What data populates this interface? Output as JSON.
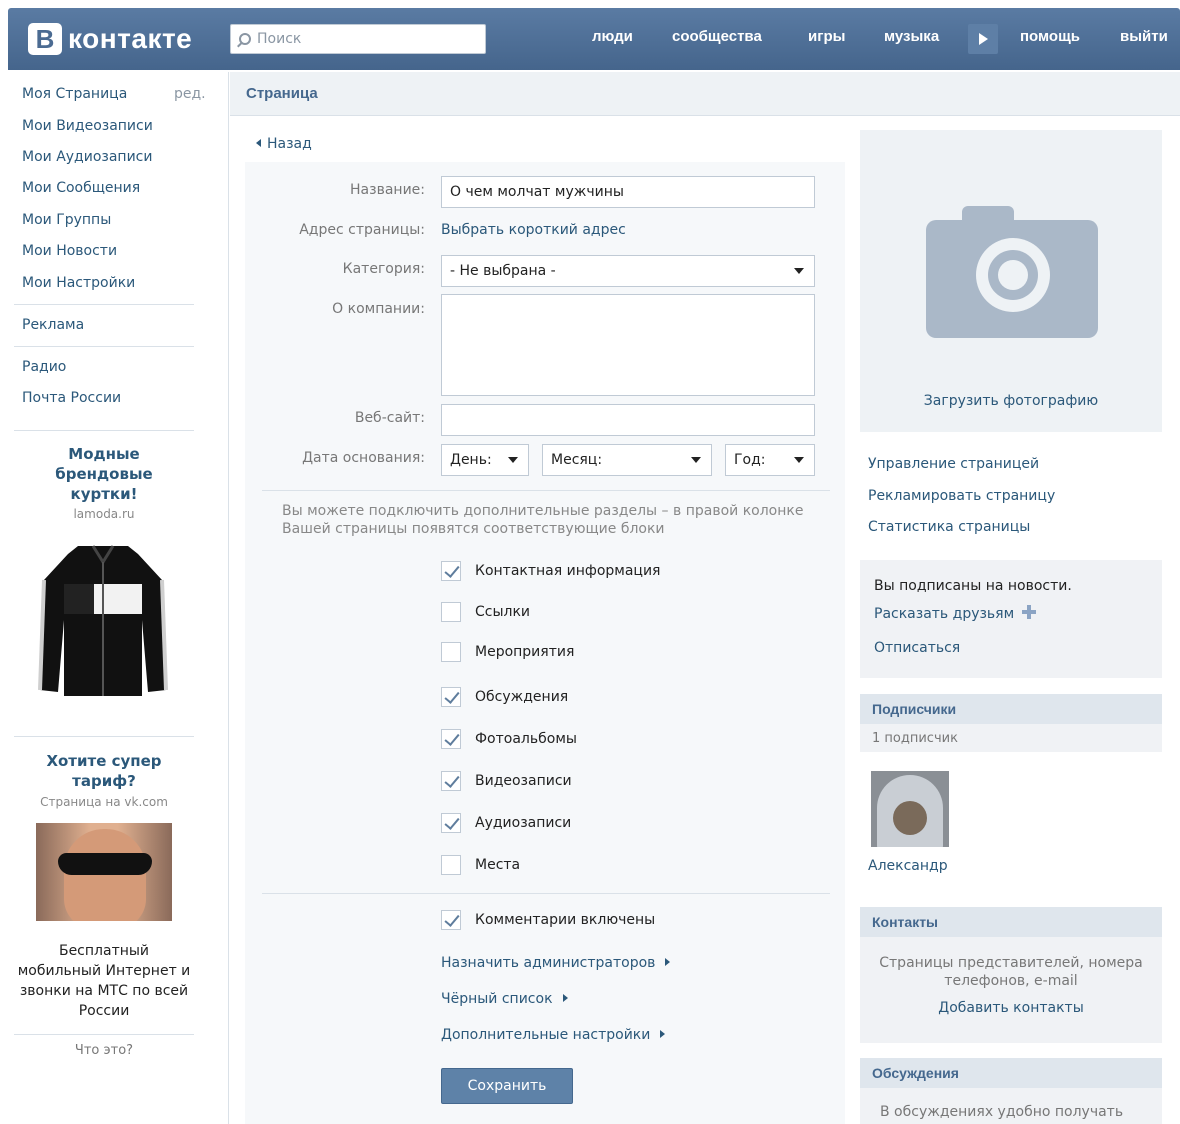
{
  "header": {
    "logo_letter": "В",
    "logo_text": "контакте",
    "search_placeholder": "Поиск",
    "nav": [
      "люди",
      "сообщества",
      "игры",
      "музыка",
      "помощь",
      "выйти"
    ]
  },
  "sidebar": {
    "items": [
      "Моя Страница",
      "Мои Видеозаписи",
      "Мои Аудиозаписи",
      "Мои Сообщения",
      "Мои Группы",
      "Мои Новости",
      "Мои Настройки"
    ],
    "edit_label": "ред.",
    "extra": [
      "Реклама",
      "Радио",
      "Почта России"
    ]
  },
  "ads": {
    "ad1": {
      "title": "Модные брендовые куртки!",
      "source": "lamoda.ru"
    },
    "ad2": {
      "title": "Хотите супер тариф?",
      "source": "Страница на vk.com",
      "text": "Бесплатный мобильный Интернет и звонки на МТС по всей России"
    },
    "what_is_this": "Что это?"
  },
  "main": {
    "section_title": "Страница",
    "back_label": "Назад",
    "labels": {
      "name": "Название:",
      "address": "Адрес страницы:",
      "category": "Категория:",
      "about": "О компании:",
      "website": "Веб-сайт:",
      "founded": "Дата основания:"
    },
    "name_value": "О чем молчат мужчины",
    "address_link": "Выбрать короткий адрес",
    "category_value": "- Не выбрана -",
    "about_value": "",
    "website_value": "",
    "day_value": "День:",
    "month_value": "Месяц:",
    "year_value": "Год:",
    "hint": "Вы можете подключить дополнительные разделы – в правой колонке Вашей страницы появятся соответствующие блоки",
    "sections": [
      {
        "label": "Контактная информация",
        "checked": true
      },
      {
        "label": "Ссылки",
        "checked": false
      },
      {
        "label": "Мероприятия",
        "checked": false
      },
      {
        "label": "Обсуждения",
        "checked": true
      },
      {
        "label": "Фотоальбомы",
        "checked": true
      },
      {
        "label": "Видеозаписи",
        "checked": true
      },
      {
        "label": "Аудиозаписи",
        "checked": true
      },
      {
        "label": "Места",
        "checked": false
      }
    ],
    "comments": {
      "label": "Комментарии включены",
      "checked": true
    },
    "links": [
      "Назначить администраторов",
      "Чёрный список",
      "Дополнительные настройки"
    ],
    "save_label": "Сохранить"
  },
  "right": {
    "upload_photo": "Загрузить фотографию",
    "manage_links": [
      "Управление страницей",
      "Рекламировать страницу",
      "Статистика страницы"
    ],
    "subscribed_text": "Вы подписаны на новости.",
    "tell_friends": "Расказать друзьям",
    "unsubscribe": "Отписаться",
    "subscribers_title": "Подписчики",
    "subscribers_count": "1 подписчик",
    "subscriber_name": "Александр",
    "contacts_title": "Контакты",
    "contacts_text": "Страницы представителей, номера телефонов, e-mail",
    "add_contacts": "Добавить контакты",
    "discussions_title": "Обсуждения",
    "discussions_text": "В обсуждениях удобно получать"
  }
}
